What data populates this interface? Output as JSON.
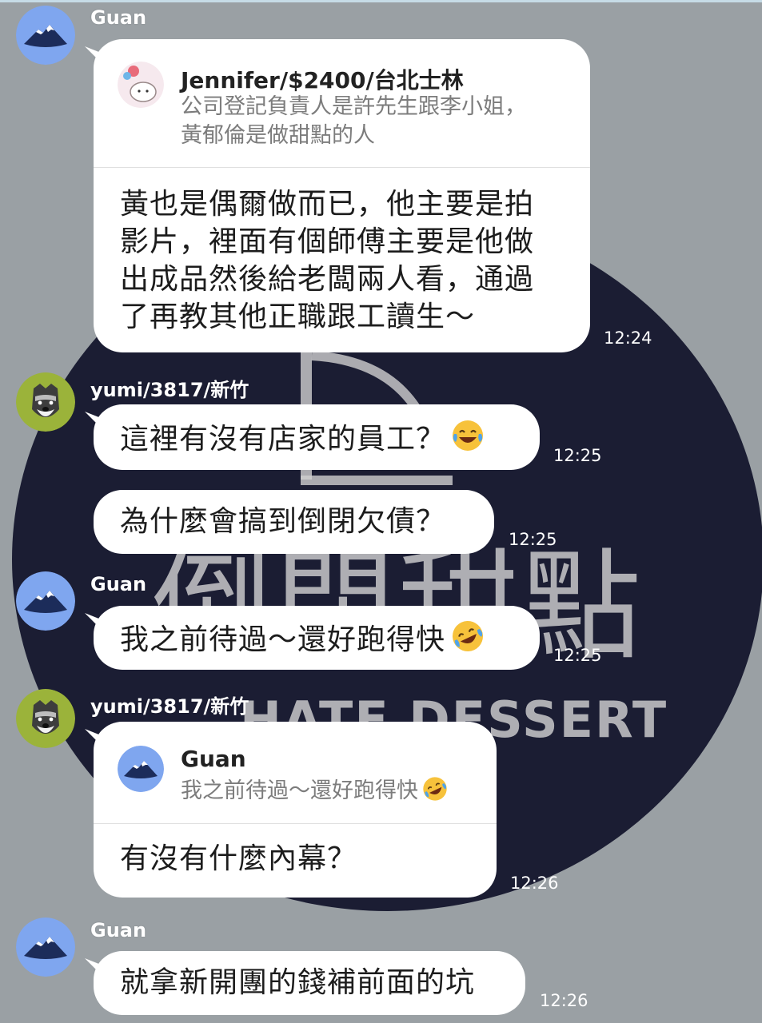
{
  "background": {
    "logo_main": "倒閉甜點",
    "logo_sub": "HATE DESSERT"
  },
  "messages": [
    {
      "sender": "Guan",
      "reply_to": {
        "name": "Jennifer/$2400/台北士林",
        "lines": [
          "公司登記負責人是許先生跟李小姐，",
          "黃郁倫是做甜點的人"
        ]
      },
      "lines": [
        "黃也是偶爾做而已，他主要是拍",
        "影片，裡面有個師傅主要是他做",
        "出成品然後給老闆兩人看，通過",
        "了再教其他正職跟工讀生～"
      ],
      "time": "12:24"
    },
    {
      "sender": "yumi/3817/新竹",
      "text": "這裡有沒有店家的員工？",
      "emoji": "face-with-tears-of-joy",
      "time": "12:25"
    },
    {
      "text": "為什麼會搞到倒閉欠債？",
      "time": "12:25"
    },
    {
      "sender": "Guan",
      "text": "我之前待過～還好跑得快",
      "emoji": "rolling-on-the-floor-laughing",
      "time": "12:25"
    },
    {
      "sender": "yumi/3817/新竹",
      "reply_to": {
        "name": "Guan",
        "text": "我之前待過～還好跑得快",
        "emoji": "rolling-on-the-floor-laughing"
      },
      "text": "有沒有什麼內幕？",
      "time": "12:26"
    },
    {
      "sender": "Guan",
      "text": "就拿新開團的錢補前面的坑",
      "time": "12:26"
    }
  ],
  "colors": {
    "background": "#9aa0a4",
    "bubble": "#ffffff",
    "logo_circle": "#1b1d33",
    "guan_avatar": "#7fa6ef",
    "yumi_avatar": "#9bb33a"
  }
}
